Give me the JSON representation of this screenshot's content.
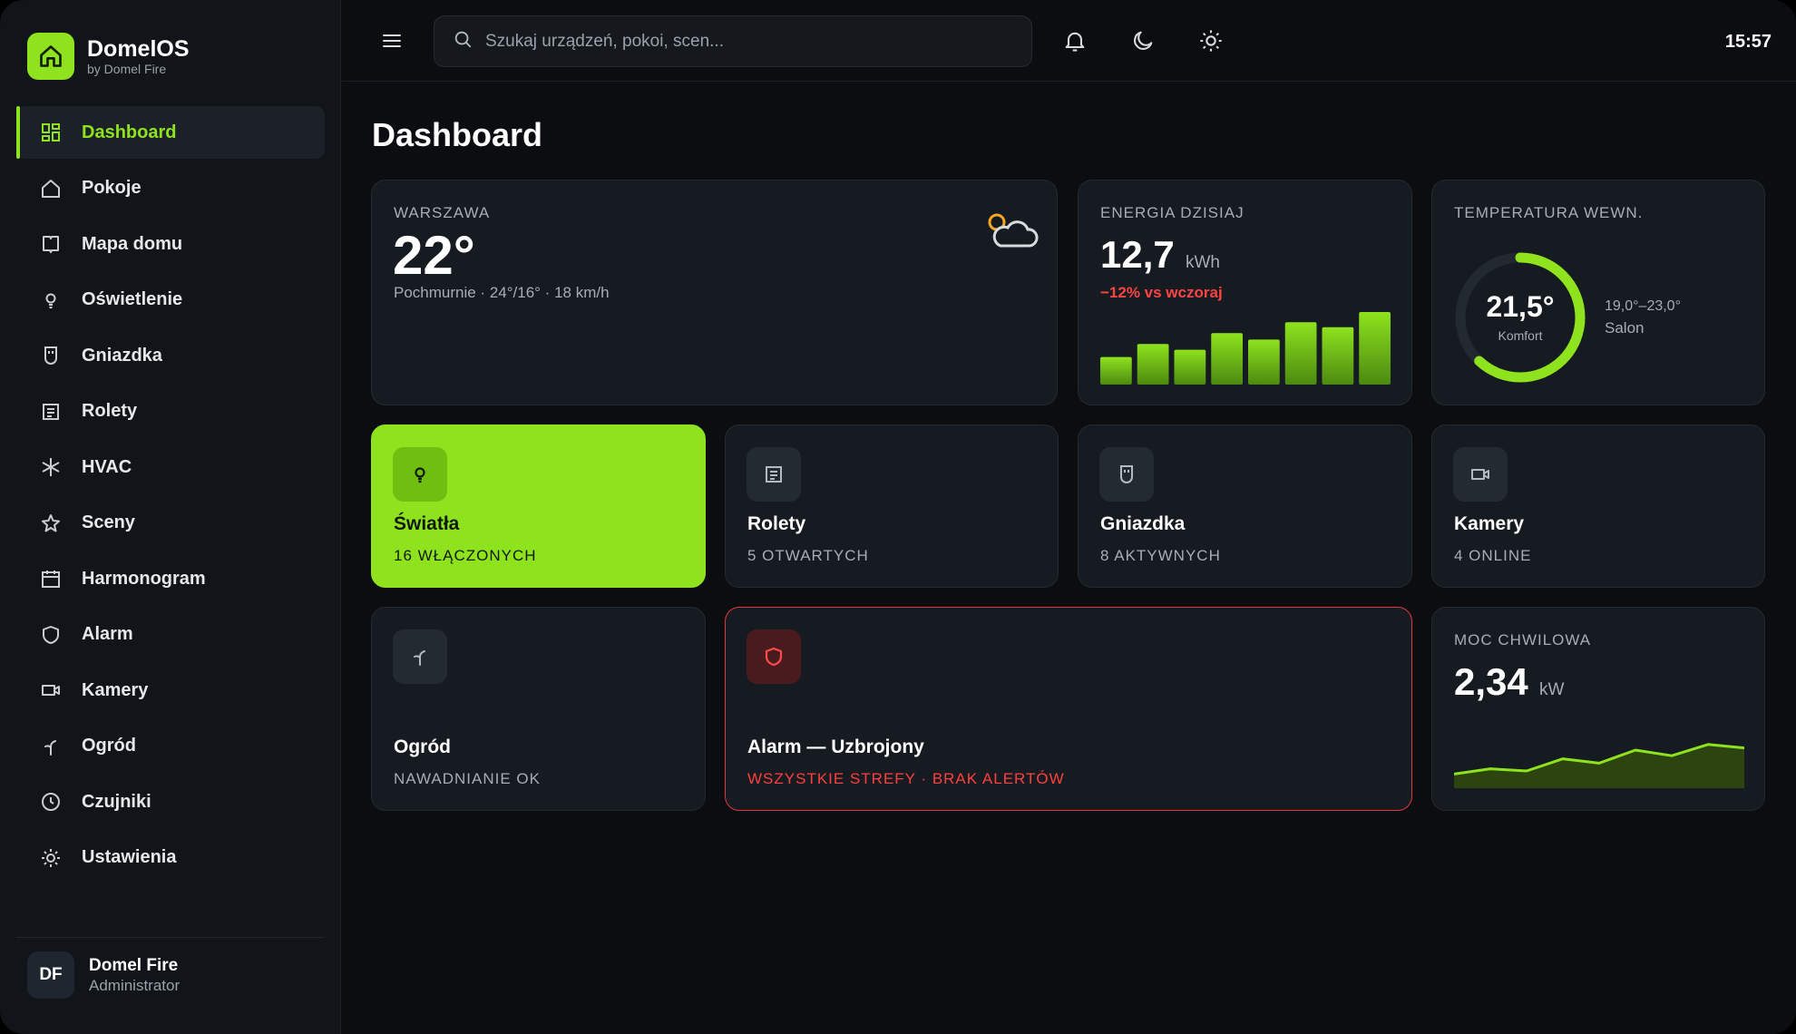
{
  "brand": {
    "name": "DomelOS",
    "sub": "by Domel Fire"
  },
  "nav": [
    {
      "label": "Dashboard",
      "icon": "grid-icon",
      "active": true
    },
    {
      "label": "Pokoje",
      "icon": "home-icon"
    },
    {
      "label": "Mapa domu",
      "icon": "map-icon"
    },
    {
      "label": "Oświetlenie",
      "icon": "bulb-icon"
    },
    {
      "label": "Gniazdka",
      "icon": "plug-icon"
    },
    {
      "label": "Rolety",
      "icon": "blinds-icon"
    },
    {
      "label": "HVAC",
      "icon": "snowflake-icon"
    },
    {
      "label": "Sceny",
      "icon": "star-icon"
    },
    {
      "label": "Harmonogram",
      "icon": "calendar-icon"
    },
    {
      "label": "Alarm",
      "icon": "shield-icon"
    },
    {
      "label": "Kamery",
      "icon": "camera-icon"
    },
    {
      "label": "Ogród",
      "icon": "sprout-icon"
    },
    {
      "label": "Czujniki",
      "icon": "clock-icon"
    },
    {
      "label": "Ustawienia",
      "icon": "gear-icon"
    }
  ],
  "user": {
    "initials": "DF",
    "name": "Domel Fire",
    "role": "Administrator"
  },
  "topbar": {
    "search_placeholder": "Szukaj urządzeń, pokoi, scen...",
    "time": "15:57"
  },
  "page": {
    "title": "Dashboard"
  },
  "weather": {
    "city": "WARSZAWA",
    "temp": "22°",
    "desc": "Pochmurnie · 24°/16° · 18 km/h"
  },
  "energy": {
    "label": "ENERGIA DZISIAJ",
    "value": "12,7",
    "unit": "kWh",
    "delta": "−12% vs wczoraj",
    "bars": [
      0.38,
      0.56,
      0.48,
      0.71,
      0.62,
      0.86,
      0.79,
      1.0
    ]
  },
  "temperature": {
    "label": "TEMPERATURA WEWN.",
    "value": "21,5°",
    "sub": "Komfort",
    "range": "19,0°–23,0°",
    "room": "Salon",
    "fraction": 0.62
  },
  "tiles": {
    "lights": {
      "title": "Światła",
      "sub": "16 WŁĄCZONYCH"
    },
    "blinds": {
      "title": "Rolety",
      "sub": "5 OTWARTYCH"
    },
    "sockets": {
      "title": "Gniazdka",
      "sub": "8 AKTYWNYCH"
    },
    "cameras": {
      "title": "Kamery",
      "sub": "4 ONLINE"
    },
    "garden": {
      "title": "Ogród",
      "sub": "NAWADNIANIE OK"
    },
    "alarm": {
      "title": "Alarm — Uzbrojony",
      "sub": "WSZYSTKIE STREFY · BRAK ALERTÓW"
    }
  },
  "power": {
    "label": "MOC CHWILOWA",
    "value": "2,34",
    "unit": "kW",
    "series": [
      0.2,
      0.32,
      0.27,
      0.55,
      0.45,
      0.75,
      0.62,
      0.88,
      0.8
    ]
  },
  "colors": {
    "accent": "#8ee21e",
    "danger": "#e0393c",
    "card": "#161b21",
    "bg": "#0b0d10"
  }
}
